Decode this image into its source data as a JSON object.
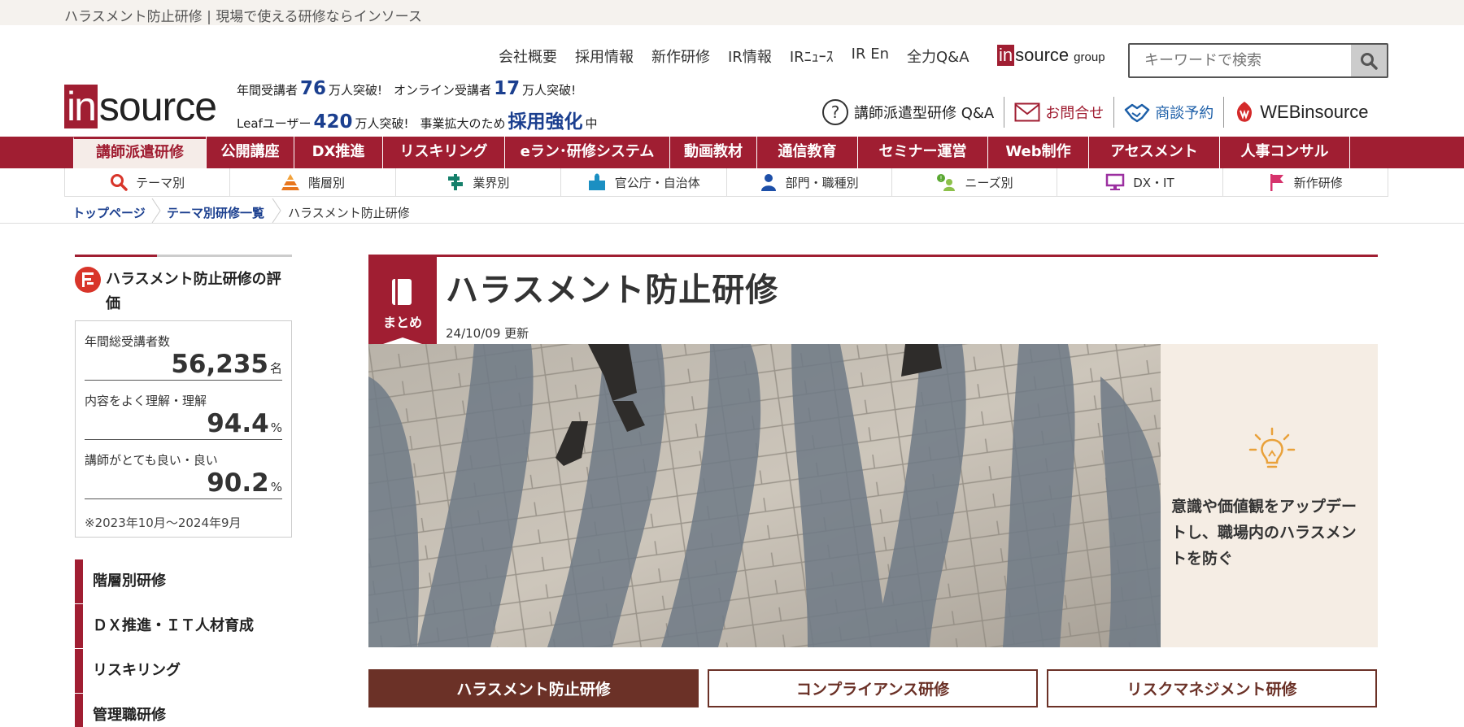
{
  "site_title": "ハラスメント防止研修 | 現場で使える研修ならインソース",
  "logo": {
    "in": "in",
    "rest": "source"
  },
  "stats": {
    "l1_a": "年間受講者",
    "l1_n1": "76",
    "l1_b": "万人突破!",
    "l1_c": "オンライン受講者",
    "l1_n2": "17",
    "l1_d": "万人突破!",
    "l2_a": "Leafユーザー",
    "l2_n1": "420",
    "l2_b": "万人突破!",
    "l2_c": "事業拡大のため",
    "l2_n2": "採用強化",
    "l2_d": "中"
  },
  "topnav": [
    "会社概要",
    "採用情報",
    "新作研修",
    "IR情報",
    "IRﾆｭｰｽ",
    "IR En",
    "全力Q&A"
  ],
  "group_logo": {
    "in": "in",
    "rest": "source",
    "group": "group"
  },
  "search": {
    "placeholder": "キーワードで検索"
  },
  "util": {
    "qa": "講師派遣型研修 Q&A",
    "contact": "お問合せ",
    "meeting": "商談予約",
    "web": "WEBinsource"
  },
  "mainnav": [
    "講師派遣研修",
    "公開講座",
    "DX推進",
    "リスキリング",
    "eラン･研修システム",
    "動画教材",
    "通信教育",
    "セミナー運営",
    "Web制作",
    "アセスメント",
    "人事コンサル"
  ],
  "subnav": [
    "テーマ別",
    "階層別",
    "業界別",
    "官公庁・自治体",
    "部門・職種別",
    "ニーズ別",
    "DX・IT",
    "新作研修"
  ],
  "breadcrumb": {
    "home": "トップページ",
    "list": "テーマ別研修一覧",
    "current": "ハラスメント防止研修"
  },
  "sidebar": {
    "eval_title": "ハラスメント防止研修の評価",
    "stats": [
      {
        "label": "年間総受講者数",
        "value": "56,235",
        "unit": "名"
      },
      {
        "label": "内容をよく理解・理解",
        "value": "94.4",
        "unit": "%"
      },
      {
        "label": "講師がとても良い・良い",
        "value": "90.2",
        "unit": "%"
      }
    ],
    "note": "※2023年10月～2024年9月",
    "links": [
      "階層別研修",
      "ＤＸ推進・ＩＴ人材育成",
      "リスキリング",
      "管理職研修"
    ]
  },
  "main": {
    "tag": "まとめ",
    "title": "ハラスメント防止研修",
    "updated": "24/10/09 更新",
    "hero_text": "意識や価値観をアップデートし、職場内のハラスメントを防ぐ",
    "tabs": [
      "ハラスメント防止研修",
      "コンプライアンス研修",
      "リスクマネジメント研修"
    ]
  },
  "colors": {
    "brand": "#a01e32",
    "tab": "#6b3127",
    "link": "#1b3f8f"
  }
}
